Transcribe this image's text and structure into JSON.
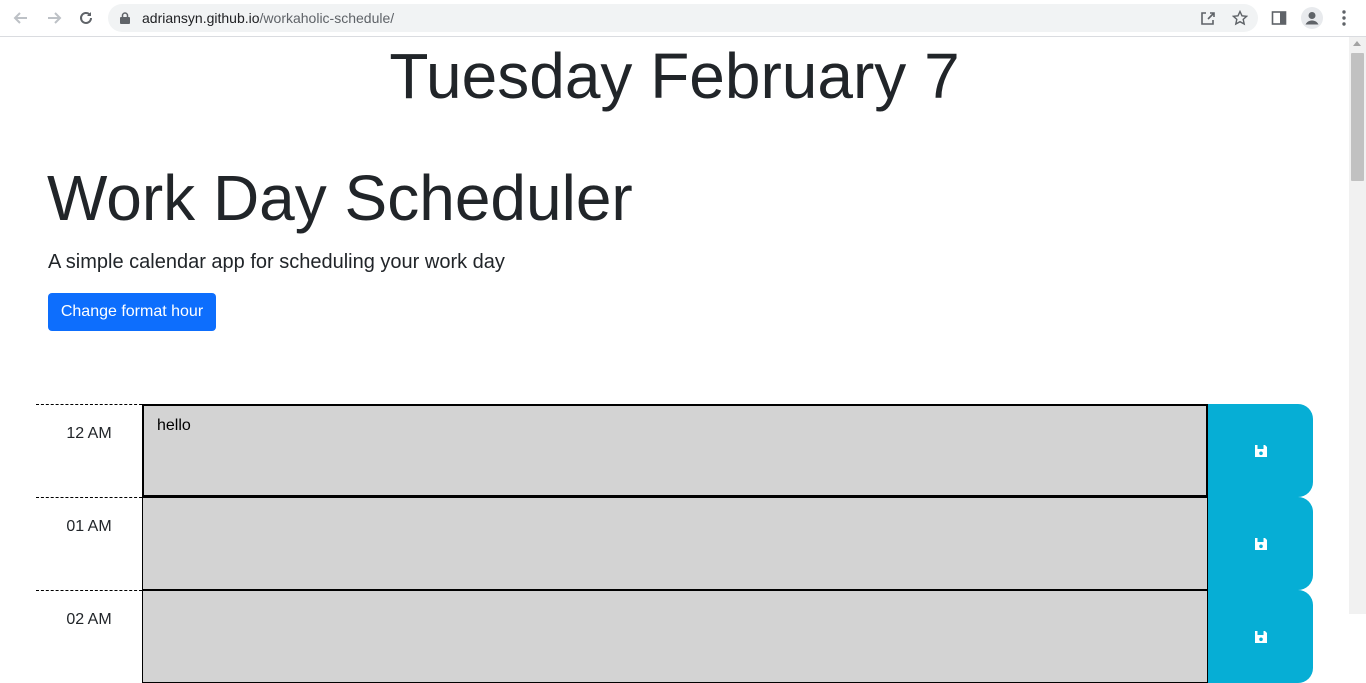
{
  "browser": {
    "url_host": "adriansyn.github.io",
    "url_path": "/workaholic-schedule/"
  },
  "header": {
    "current_day": "Tuesday February 7",
    "title": "Work Day Scheduler",
    "lead": "A simple calendar app for scheduling your work day",
    "format_button_label": "Change format hour"
  },
  "time_blocks": [
    {
      "hour": "12 AM",
      "text": "hello"
    },
    {
      "hour": "01 AM",
      "text": ""
    },
    {
      "hour": "02 AM",
      "text": ""
    }
  ],
  "colors": {
    "past": "#d3d3d3",
    "save": "#06aed5",
    "primary": "#0d6efd"
  },
  "icons": {
    "save": "floppy-disk-icon",
    "back": "arrow-left-icon",
    "forward": "arrow-right-icon",
    "reload": "reload-icon",
    "lock": "lock-icon",
    "share": "share-icon",
    "bookmark": "star-icon",
    "side_panel": "side-panel-icon",
    "profile": "profile-icon",
    "menu": "kebab-menu-icon"
  }
}
